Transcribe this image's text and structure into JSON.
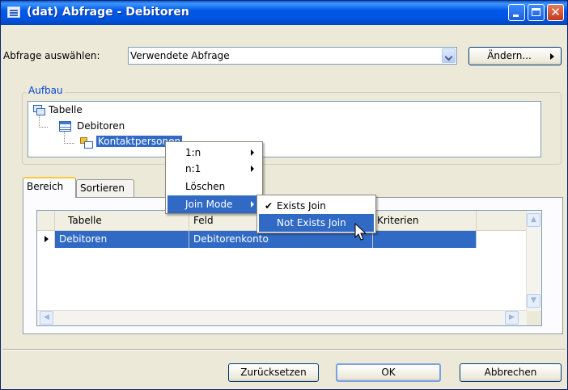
{
  "window": {
    "title": "(dat) Abfrage - Debitoren",
    "close_glyph": "✕"
  },
  "query": {
    "label": "Abfrage auswählen:",
    "value": "Verwendete Abfrage",
    "change_button": "Ändern..."
  },
  "structure": {
    "group_label": "Aufbau",
    "nodes": [
      "Tabelle",
      "Debitoren",
      "Kontaktpersonen"
    ]
  },
  "tabs": [
    "Bereich",
    "Sortieren"
  ],
  "grid": {
    "columns": [
      "Tabelle",
      "Feld",
      "Kriterien"
    ],
    "rows": [
      {
        "tabelle": "Debitoren",
        "feld": "Debitorenkonto",
        "kriterien": ""
      }
    ]
  },
  "context_menu": {
    "items": [
      "1:n",
      "n:1",
      "Löschen",
      "Join Mode"
    ],
    "submenu": {
      "items": [
        "Exists Join",
        "Not Exists Join"
      ],
      "checked": "Exists Join"
    }
  },
  "buttons": {
    "reset": "Zurücksetzen",
    "ok": "OK",
    "cancel": "Abbrechen"
  },
  "colors": {
    "title_bar": "#0054e3",
    "selection": "#316ac5",
    "dialog_bg": "#ece9d8"
  }
}
